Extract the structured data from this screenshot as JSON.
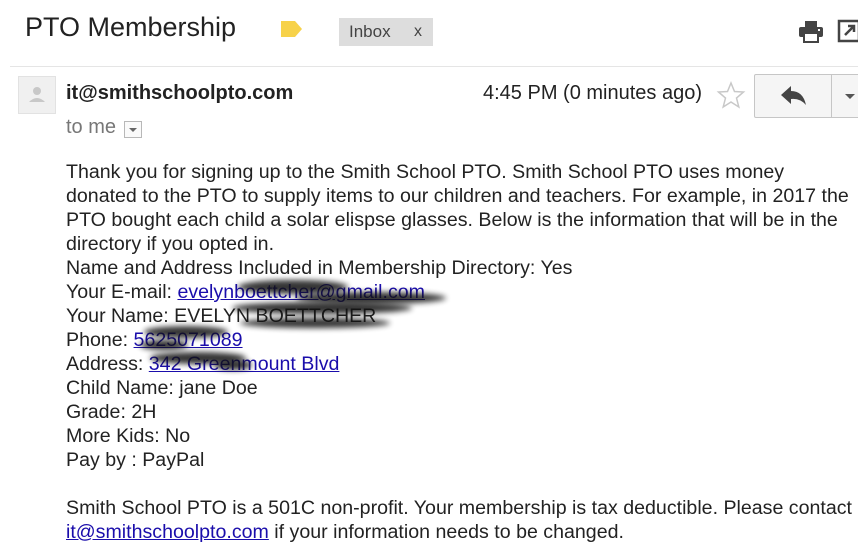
{
  "header": {
    "subject": "PTO Membership",
    "label_chip": "Inbox",
    "label_remove": "x"
  },
  "message": {
    "sender": "it@smithschoolpto.com",
    "time": "4:45 PM (0 minutes ago)",
    "recipient_line": "to me",
    "intro": "Thank you for signing up to the Smith School PTO.  Smith School PTO uses money donated to the PTO to supply items to our children and teachers.  For example, in 2017 the PTO bought each child a solar elispse glasses.  Below is the information that will be in the directory if you opted in.",
    "directory_line": "Name and Address Included in Membership Directory: Yes",
    "email_label": "Your E-mail: ",
    "email_value": "evelynboettcher@gmail.com",
    "name_line": "Your Name: EVELYN BOETTCHER",
    "phone_label": "Phone: ",
    "phone_value": "5625071089",
    "address_label": "Address: ",
    "address_value": "342 Greenmount Blvd",
    "child_line": "Child Name: jane Doe",
    "grade_line": "Grade: 2H",
    "kids_line": "More Kids: No",
    "pay_line": "Pay by : PayPal",
    "footer_before": "Smith School PTO is a  501C non-profit.  Your membership is tax deductible.   Please contact ",
    "footer_link": "it@smithschoolpto.com",
    "footer_after": " if your information needs to be changed."
  },
  "colors": {
    "link": "#1a0dab",
    "label_tag": "#f7d24a",
    "chip_bg": "#dddddd"
  },
  "icons": [
    "label-tag-icon",
    "print-icon",
    "popout-icon",
    "avatar-icon",
    "star-icon",
    "reply-icon",
    "chevron-down-icon"
  ]
}
